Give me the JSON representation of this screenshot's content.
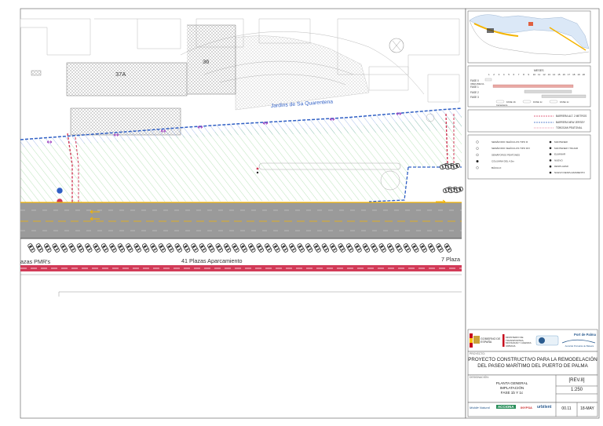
{
  "plan": {
    "parcel_1": "37A",
    "parcel_2": "36",
    "garden_label": "Jardins de Sa Quarentena",
    "left_label": "azas PMR's",
    "center_label": "41 Plazas Aparcamiento",
    "right_label": "7 Plaza"
  },
  "legend_phases": {
    "header": "MESES",
    "months": [
      "1",
      "2",
      "3",
      "4",
      "5",
      "6",
      "7",
      "8",
      "9",
      "10",
      "11",
      "12",
      "13",
      "14",
      "15",
      "16",
      "17",
      "18",
      "19",
      "20"
    ],
    "rows": [
      "FASE 0",
      "FASE 1",
      "FASE 2",
      "FASE 3"
    ],
    "row0_sub": "OBRA PREVIA",
    "keys": [
      "FASE 1b",
      "FASE 1c",
      "FASE 1c"
    ],
    "note": "Cerramiento",
    "colors": {
      "fase1": "#e9a9a4",
      "fase2": "#d8d8d8",
      "fase3": "#d8d8d8"
    }
  },
  "legend_lines": {
    "items": [
      "BARRERA ALT. 2 METROS",
      "BARRERA NEW JERSEY",
      "TOBOGAN PEATONAL"
    ],
    "colors": [
      "#d9345a",
      "#3060c0",
      "#e07090"
    ]
  },
  "legend_symbols": {
    "left": [
      "SEMÁFORO VEHÍCULOS TIPO R",
      "SEMÁFORO VEHÍCULOS TIPO R/V",
      "SEMÁFOROS PEATONES",
      "COLUMNA DEL 4,5m",
      "BÁCULO"
    ],
    "right": [
      "MANTENER",
      "MANTENER Y BAJAR",
      "ELIMINAR",
      "NUEVO",
      "DESPLAZAR",
      "NUEVO DESPLAZAMIENTO"
    ]
  },
  "title_block": {
    "authority_left": "GOBIERNO DE ESPAÑA",
    "ministry": "MINISTERIO DE TRANSPORTES, MOVILIDAD Y AGENDA URBANA",
    "port_name": "Port de Palma",
    "port_authority": "Autoritat Portuària de Balears",
    "project_caption": "PROYECTO:",
    "project_line1": "PROYECTO CONSTRUCTIVO PARA LA REMODELACIÓN",
    "project_line2": "DEL PASEO MARÍTIMO DEL PUERTO DE PALMA",
    "drawing_caption": "DESIGNACIÓN:",
    "drawing_line1": "PLANTA GENERAL",
    "drawing_line2": "IMPLATACIÓN",
    "drawing_line3": "FASE 1b Y 1c",
    "revision": "[REV.8]",
    "scale": "1:250",
    "sheet_no": "00.11",
    "date": "18-MAY",
    "logos": [
      "Mobile Natural",
      "ACCIONA",
      "INYPSA",
      "urbilent"
    ]
  },
  "colors": {
    "road": "#9a9a9a",
    "hatch": "#8fd18f",
    "blue_barrier": "#2f5fc4",
    "red_barrier": "#d23a57",
    "yellow_line": "#f4b400",
    "border": "#555555"
  }
}
